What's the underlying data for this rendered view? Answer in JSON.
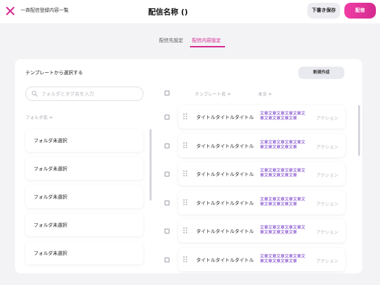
{
  "header": {
    "breadcrumb": "一斉配信登録内容一覧",
    "title": "配信名称 ()",
    "draft_label": "下書き保存",
    "send_label": "配信",
    "accent": "#d5268f"
  },
  "tabs": [
    {
      "label": "配信先設定",
      "active": false
    },
    {
      "label": "配信内容設定",
      "active": true
    }
  ],
  "panel": {
    "title": "テンプレートから選択する",
    "new_label": "新規作成"
  },
  "search": {
    "placeholder": "フォルダとタグ名を入力",
    "value": ""
  },
  "folders": {
    "header": "フォルダ名 ≑",
    "items": [
      "フォルダ未選択",
      "フォルダ未選択",
      "フォルダ未選択",
      "フォルダ未選択",
      "フォルダ未選択"
    ]
  },
  "table": {
    "col_name": "テンプレート名 ≑",
    "col_body": "本文 ≑",
    "rows": [
      {
        "name": "タイトルタイトルタイトル",
        "body": "文章文章文章文章文章文章文章文章文章文章",
        "action": "アクション"
      },
      {
        "name": "タイトルタイトルタイトル",
        "body": "文章文章文章文章文章文章文章文章文章文章",
        "action": "アクション"
      },
      {
        "name": "タイトルタイトルタイトル",
        "body": "文章文章文章文章文章文章文章文章文章文章",
        "action": "アクション"
      },
      {
        "name": "タイトルタイトルタイトル",
        "body": "文章文章文章文章文章文章文章文章文章文章",
        "action": "アクション"
      },
      {
        "name": "タイトルタイトルタイトル",
        "body": "文章文章文章文章文章文章文章文章文章文章",
        "action": "アクション"
      },
      {
        "name": "タイトルタイトルタイトル",
        "body": "文章文章文章文章文章文章文章文章文章文章",
        "action": "アクション"
      }
    ]
  },
  "icons": {
    "close": "close-icon",
    "search": "search-icon",
    "drag": "drag-handle-icon"
  }
}
